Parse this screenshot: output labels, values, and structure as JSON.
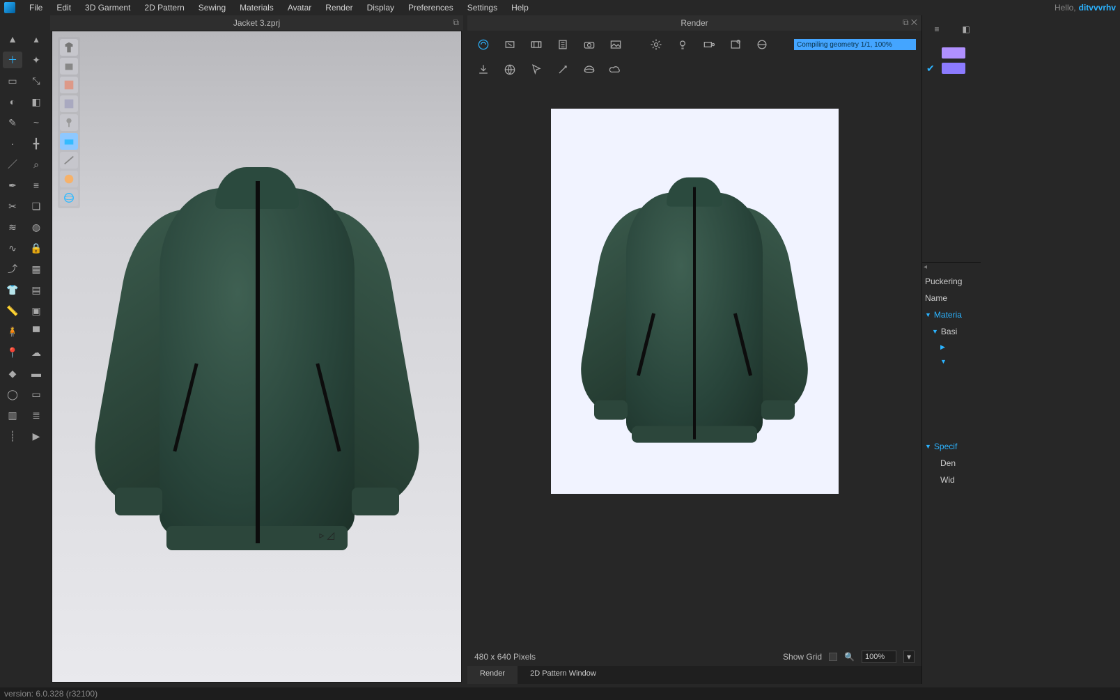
{
  "menu": {
    "items": [
      "File",
      "Edit",
      "3D Garment",
      "2D Pattern",
      "Sewing",
      "Materials",
      "Avatar",
      "Render",
      "Display",
      "Preferences",
      "Settings",
      "Help"
    ],
    "hello": "Hello,",
    "user": "ditvvvrhv"
  },
  "panel3d": {
    "title": "Jacket 3.zprj"
  },
  "modeButtons": [
    "garment-display",
    "avatar-display",
    "texture-surface",
    "arrangement",
    "pin",
    "shade-mode",
    "stress-map",
    "avatar-skin",
    "globe"
  ],
  "renderPanel": {
    "title": "Render",
    "progress": "Compiling geometry 1/1, 100%",
    "canvasInfo": "480 x 640 Pixels",
    "showGridLabel": "Show Grid",
    "zoom": "100%",
    "tabs": [
      "Render",
      "2D Pattern Window"
    ]
  },
  "rightPanel": {
    "layerSwatches": [
      "#b090ff",
      "#8c7bff"
    ],
    "props": {
      "puckering": "Puckering",
      "name": "Name",
      "material": "Materia",
      "basic": "Basi",
      "specific": "Specif",
      "density": "Den",
      "width": "Wid"
    }
  },
  "status": "version: 6.0.328 (r32100)"
}
